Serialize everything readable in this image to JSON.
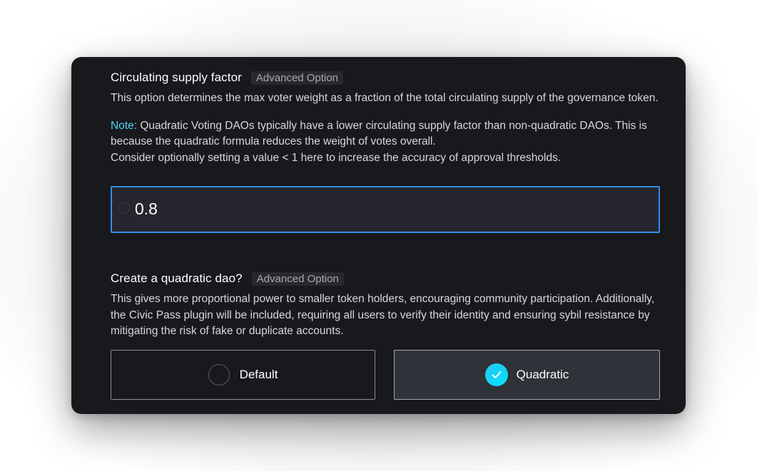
{
  "supply_factor": {
    "heading": "Circulating supply factor",
    "badge": "Advanced Option",
    "description": "This option determines the max voter weight as a fraction of the total circulating supply of the governance token.",
    "note_label": "Note:",
    "note_text": " Quadratic Voting DAOs typically have a lower circulating supply factor than non-quadratic DAOs. This is because the quadratic formula reduces the weight of votes overall.",
    "note_text_2": "Consider optionally setting a value < 1 here to increase the accuracy of approval thresholds.",
    "input_value": "0.8",
    "input_icon": "circle-icon"
  },
  "quadratic": {
    "heading": "Create a quadratic dao?",
    "badge": "Advanced Option",
    "description": "This gives more proportional power to smaller token holders, encouraging community participation. Additionally, the Civic Pass plugin will be included, requiring all users to verify their identity and ensuring sybil resistance by mitigating the risk of fake or duplicate accounts.",
    "options": [
      {
        "label": "Default",
        "selected": false
      },
      {
        "label": "Quadratic",
        "selected": true
      }
    ],
    "check_icon": "check-icon",
    "accent_color": "#00e2ff"
  }
}
